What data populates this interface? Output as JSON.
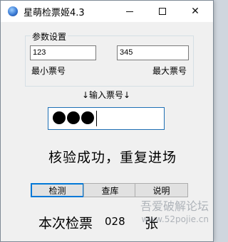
{
  "window": {
    "title": "星萌检票姬4.3",
    "minimize_icon": "minimize-icon",
    "maximize_icon": "maximize-icon",
    "close_icon": "close-icon",
    "close_glyph": "✕"
  },
  "params": {
    "group_title": "参数设置",
    "min_ticket": {
      "label": "最小票号",
      "value": "123"
    },
    "max_ticket": {
      "label": "最大票号",
      "value": "345"
    }
  },
  "ticket_input": {
    "label": "↓输入票号↓",
    "masked_chars": 3
  },
  "status_message": "核验成功，重复进场",
  "buttons": {
    "check": "检测",
    "query": "查库",
    "help": "说明"
  },
  "count": {
    "label": "本次检票",
    "value": "028",
    "unit": "张"
  },
  "watermark": {
    "line1": "吾爱破解论坛",
    "line2": "www.52pojie.cn"
  },
  "colors": {
    "accent": "#0078d7",
    "input_border": "#1e6fb4"
  }
}
